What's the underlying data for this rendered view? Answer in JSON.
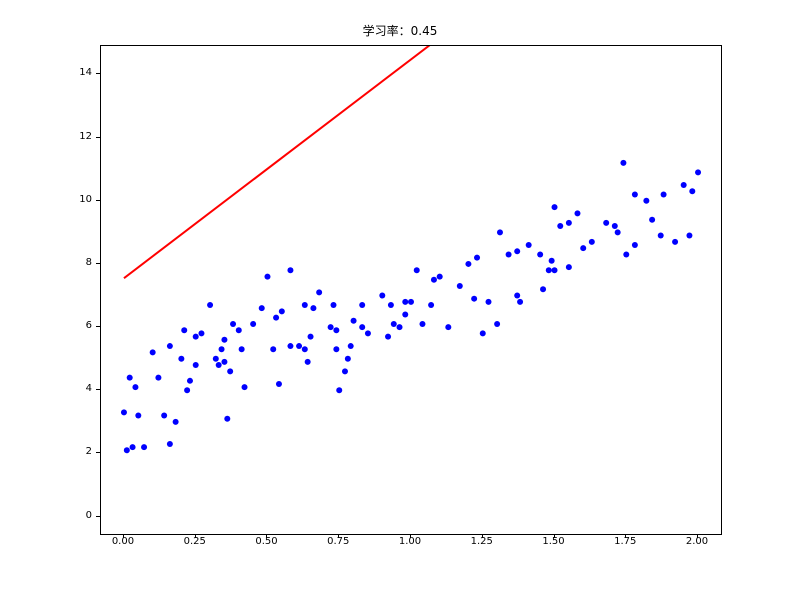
{
  "chart_data": {
    "type": "scatter",
    "title": "学习率：0.45",
    "xlabel": "",
    "ylabel": "",
    "xlim": [
      -0.08,
      2.08
    ],
    "ylim": [
      -0.55,
      14.9
    ],
    "xticks": [
      0.0,
      0.25,
      0.5,
      0.75,
      1.0,
      1.25,
      1.5,
      1.75,
      2.0
    ],
    "yticks": [
      0,
      2,
      4,
      6,
      8,
      10,
      12,
      14
    ],
    "series": [
      {
        "name": "scatter",
        "type": "scatter",
        "color": "#0000ff",
        "x": [
          0.0,
          0.01,
          0.02,
          0.03,
          0.04,
          0.05,
          0.07,
          0.1,
          0.12,
          0.14,
          0.16,
          0.16,
          0.18,
          0.2,
          0.21,
          0.22,
          0.23,
          0.25,
          0.25,
          0.27,
          0.3,
          0.32,
          0.33,
          0.34,
          0.35,
          0.35,
          0.36,
          0.37,
          0.38,
          0.4,
          0.41,
          0.42,
          0.45,
          0.48,
          0.5,
          0.52,
          0.53,
          0.54,
          0.55,
          0.58,
          0.58,
          0.61,
          0.63,
          0.63,
          0.64,
          0.65,
          0.66,
          0.68,
          0.72,
          0.73,
          0.74,
          0.74,
          0.75,
          0.77,
          0.78,
          0.79,
          0.8,
          0.83,
          0.83,
          0.85,
          0.9,
          0.92,
          0.93,
          0.94,
          0.96,
          0.98,
          0.98,
          1.0,
          1.02,
          1.04,
          1.07,
          1.08,
          1.1,
          1.13,
          1.17,
          1.2,
          1.22,
          1.23,
          1.25,
          1.27,
          1.3,
          1.31,
          1.34,
          1.37,
          1.37,
          1.38,
          1.41,
          1.45,
          1.46,
          1.48,
          1.49,
          1.5,
          1.5,
          1.52,
          1.55,
          1.55,
          1.58,
          1.6,
          1.63,
          1.68,
          1.71,
          1.72,
          1.74,
          1.75,
          1.78,
          1.78,
          1.82,
          1.84,
          1.87,
          1.88,
          1.92,
          1.95,
          1.97,
          1.98,
          2.0
        ],
        "y": [
          3.3,
          2.1,
          4.4,
          2.2,
          4.1,
          3.2,
          2.2,
          5.2,
          4.4,
          3.2,
          2.3,
          5.4,
          3.0,
          5.0,
          5.9,
          4.0,
          4.3,
          4.8,
          5.7,
          5.8,
          6.7,
          5.0,
          4.8,
          5.3,
          5.6,
          4.9,
          3.1,
          4.6,
          6.1,
          5.9,
          5.3,
          4.1,
          6.1,
          6.6,
          7.6,
          5.3,
          6.3,
          4.2,
          6.5,
          7.8,
          5.4,
          5.4,
          5.3,
          6.7,
          4.9,
          5.7,
          6.6,
          7.1,
          6.0,
          6.7,
          5.9,
          5.3,
          4.0,
          4.6,
          5.0,
          5.4,
          6.2,
          6.7,
          6.0,
          5.8,
          7.0,
          5.7,
          6.7,
          6.1,
          6.0,
          6.8,
          6.4,
          6.8,
          7.8,
          6.1,
          6.7,
          7.5,
          7.6,
          6.0,
          7.3,
          8.0,
          6.9,
          8.2,
          5.8,
          6.8,
          6.1,
          9.0,
          8.3,
          7.0,
          8.4,
          6.8,
          8.6,
          8.3,
          7.2,
          7.8,
          8.1,
          9.8,
          7.8,
          9.2,
          7.9,
          9.3,
          9.6,
          8.5,
          8.7,
          9.3,
          9.2,
          9.0,
          11.2,
          8.3,
          8.6,
          10.2,
          10.0,
          9.4,
          8.9,
          10.2,
          8.7,
          10.5,
          8.9,
          10.3,
          10.9
        ]
      },
      {
        "name": "line",
        "type": "line",
        "color": "#ff0000",
        "linewidth": 2,
        "x": [
          0.0,
          2.0
        ],
        "y": [
          7.55,
          21.4
        ]
      }
    ]
  }
}
